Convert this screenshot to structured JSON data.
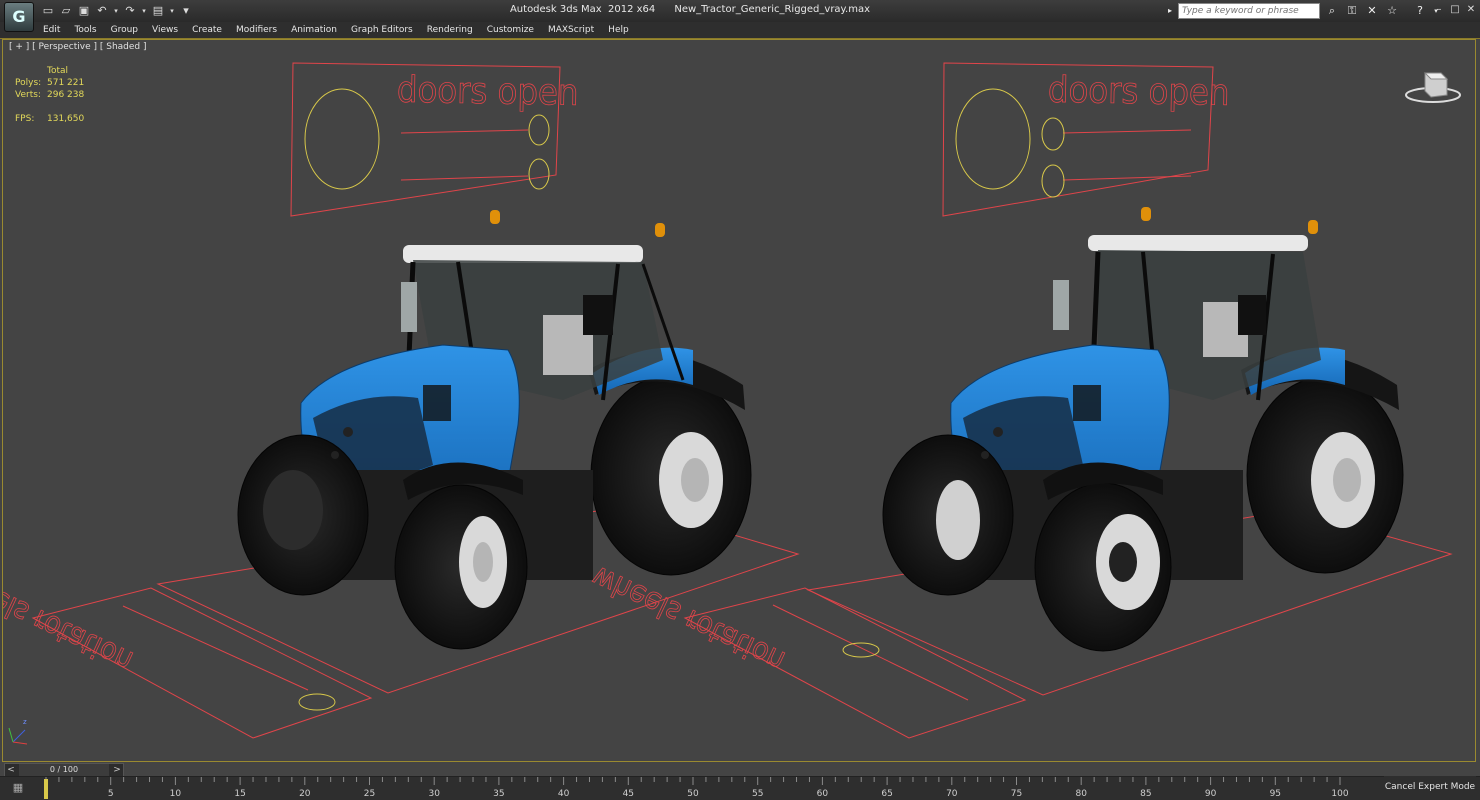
{
  "window": {
    "app_title": "Autodesk 3ds Max  2012 x64",
    "file_name": "New_Tractor_Generic_Rigged_vray.max",
    "search_placeholder": "Type a keyword or phrase"
  },
  "quick_access": [
    "new-file-icon",
    "open-file-icon",
    "save-icon",
    "undo-icon",
    "dropdown-icon",
    "redo-icon",
    "dropdown-icon",
    "project-folder-icon",
    "dropdown-icon",
    "customize-dropdown-icon"
  ],
  "menu": [
    "Edit",
    "Tools",
    "Group",
    "Views",
    "Create",
    "Modifiers",
    "Animation",
    "Graph Editors",
    "Rendering",
    "Customize",
    "MAXScript",
    "Help"
  ],
  "viewport": {
    "label": "[ + ] [ Perspective ] [ Shaded ]",
    "stats": {
      "header": "Total",
      "polys_label": "Polys:",
      "polys_value": "571 221",
      "verts_label": "Verts:",
      "verts_value": "296 238",
      "fps_label": "FPS:",
      "fps_value": "131,650"
    },
    "doors_label": "doors open",
    "wheels_label": "wheels rotation",
    "colors": {
      "background": "#444444",
      "tractor_body": "#1f7fd6",
      "helper_red": "#e0454a",
      "helper_yellow": "#d8c84a"
    }
  },
  "timeline": {
    "slider_value": "0 / 100",
    "prev_symbol": "<",
    "next_symbol": ">",
    "ticks": [
      "5",
      "10",
      "15",
      "20",
      "25",
      "30",
      "35",
      "40",
      "45",
      "50",
      "55",
      "60",
      "65",
      "70",
      "75",
      "80",
      "85",
      "90",
      "95",
      "100"
    ],
    "start": 0,
    "end": 100
  },
  "status": {
    "cancel_expert": "Cancel Expert Mode"
  }
}
